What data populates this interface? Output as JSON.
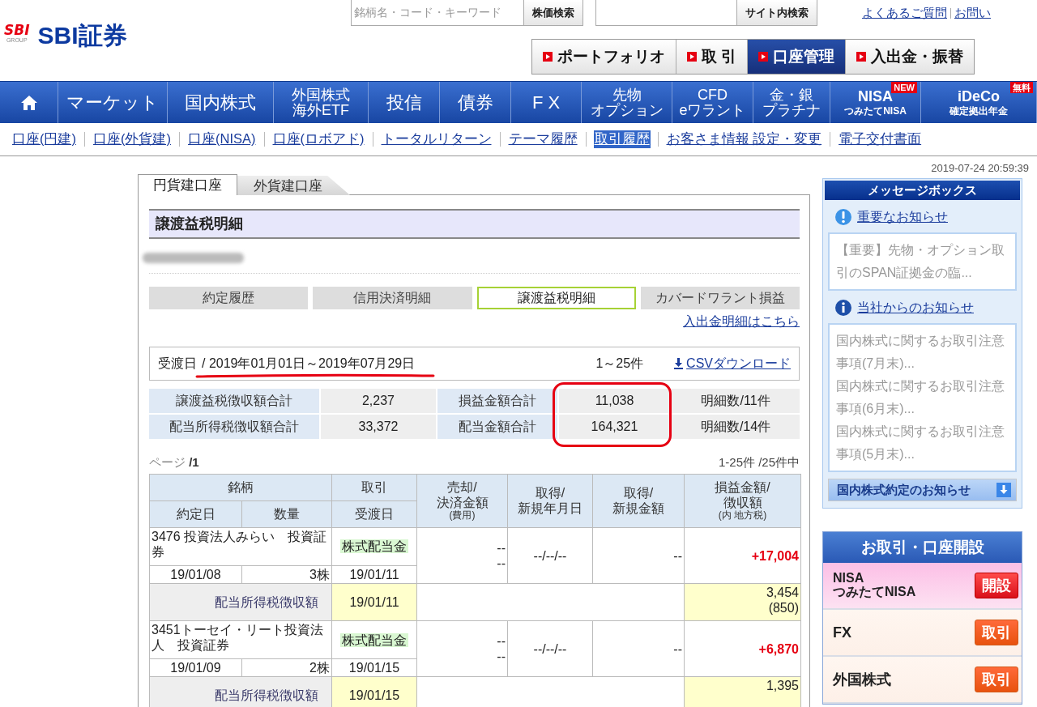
{
  "logo": {
    "mark": "SBI",
    "caption": "GROUP",
    "name": "SBI証券"
  },
  "stock_search": {
    "placeholder": "銘柄名・コード・キーワード",
    "button": "株価検索"
  },
  "site_search": {
    "button": "サイト内検索"
  },
  "help_links": [
    "よくあるご質問",
    "お問い"
  ],
  "quick_nav": [
    {
      "label": "ポートフォリオ",
      "selected": false
    },
    {
      "label": "取 引",
      "selected": false
    },
    {
      "label": "口座管理",
      "selected": true
    },
    {
      "label": "入出金・振替",
      "selected": false
    }
  ],
  "main_nav": [
    {
      "kind": "home"
    },
    {
      "kind": "label",
      "lines": [
        "マーケット"
      ]
    },
    {
      "kind": "label",
      "lines": [
        "国内株式"
      ]
    },
    {
      "kind": "stacked",
      "lines": [
        "外国株式",
        "海外ETF"
      ]
    },
    {
      "kind": "label",
      "lines": [
        "投信"
      ]
    },
    {
      "kind": "label",
      "lines": [
        "債券"
      ]
    },
    {
      "kind": "label",
      "lines": [
        "F X"
      ]
    },
    {
      "kind": "stacked",
      "lines": [
        "先物",
        "オプション"
      ]
    },
    {
      "kind": "stacked",
      "lines": [
        "CFD",
        "eワラント"
      ]
    },
    {
      "kind": "stacked",
      "lines": [
        "金・銀",
        "プラチナ"
      ]
    },
    {
      "kind": "brand",
      "lines": [
        "NISA",
        "つみたてNISA"
      ],
      "badge": "NEW"
    },
    {
      "kind": "brand",
      "lines": [
        "iDeCo",
        "確定拠出年金"
      ],
      "badge": "無料"
    }
  ],
  "sub_nav": [
    {
      "label": "口座(円建)",
      "selected": false
    },
    {
      "label": "口座(外貨建)",
      "selected": false
    },
    {
      "label": "口座(NISA)",
      "selected": false
    },
    {
      "label": "口座(ロボアド)",
      "selected": false
    },
    {
      "label": "トータルリターン",
      "selected": false
    },
    {
      "label": "テーマ履歴",
      "selected": false
    },
    {
      "label": "取引履歴",
      "selected": true
    },
    {
      "label": "お客さま情報 設定・変更",
      "selected": false
    },
    {
      "label": "電子交付書面",
      "selected": false
    }
  ],
  "timestamp": "2019-07-24 20:59:39",
  "account_tabs": [
    {
      "label": "円貨建口座",
      "selected": true
    },
    {
      "label": "外貨建口座",
      "selected": false
    }
  ],
  "section_title": "譲渡益税明細",
  "report_tabs": [
    {
      "label": "約定履歴",
      "selected": false
    },
    {
      "label": "信用決済明細",
      "selected": false
    },
    {
      "label": "譲渡益税明細",
      "selected": true
    },
    {
      "label": "カバードワラント損益",
      "selected": false
    }
  ],
  "deposit_link": "入出金明細はこちら",
  "filter": {
    "label": "受渡日",
    "period": "/ 2019年01月01日～2019年07月29日",
    "underlined": true,
    "range": "1～25件",
    "csv_link": "CSVダウンロード"
  },
  "summary": {
    "columns": [
      {
        "kind": "label",
        "cells": [
          "譲渡益税徴収額合計",
          "配当所得税徴収額合計"
        ]
      },
      {
        "kind": "value",
        "cells": [
          "2,237",
          "33,372"
        ]
      },
      {
        "kind": "label",
        "cells": [
          "損益金額合計",
          "配当金額合計"
        ]
      },
      {
        "kind": "value",
        "cells": [
          "11,038",
          "164,321"
        ],
        "circled": true
      },
      {
        "kind": "count",
        "cells": [
          "明細数/11件",
          "明細数/14件"
        ]
      }
    ]
  },
  "pager": {
    "page": "ページ **/1**",
    "count": "1-25件 /25件中"
  },
  "table": {
    "header_top": [
      "銘柄",
      "取引"
    ],
    "header_bottom": [
      "約定日",
      "数量",
      "受渡日"
    ],
    "header_tall": [
      {
        "lines": [
          "売却/",
          "決済金額"
        ],
        "note": "(費用)"
      },
      {
        "lines": [
          "取得/",
          "新規年月日"
        ]
      },
      {
        "lines": [
          "取得/",
          "新規金額"
        ]
      },
      {
        "lines": [
          "損益金額/",
          "徴収額"
        ],
        "note": "(内 地方税)"
      }
    ],
    "rows": [
      {
        "kind": "trade",
        "name": "3476 投資法人みらい　投資証券",
        "trade_type": "株式配当金",
        "trade_date": "19/01/08",
        "quantity": "3株",
        "settle_date": "19/01/11",
        "sale": [
          "--",
          "--"
        ],
        "acquired_date": "--/--/--",
        "acquired_amount": "--",
        "profit": "+17,004"
      },
      {
        "kind": "tax",
        "label": "配当所得税徴収額",
        "date": "19/01/11",
        "amount": "3,454",
        "local_tax": "(850)"
      },
      {
        "kind": "trade",
        "name": "3451トーセイ・リート投資法人　投資証券",
        "trade_type": "株式配当金",
        "trade_date": "19/01/09",
        "quantity": "2株",
        "settle_date": "19/01/15",
        "sale": [
          "--",
          "--"
        ],
        "acquired_date": "--/--/--",
        "acquired_amount": "--",
        "profit": "+6,870"
      },
      {
        "kind": "tax",
        "label": "配当所得税徴収額",
        "date": "19/01/15",
        "amount": "1,395"
      }
    ]
  },
  "message_box": {
    "title": "メッセージボックス",
    "sections": [
      {
        "kind": "important",
        "link": "重要なお知らせ",
        "items": [
          "【重要】先物・オプション取引のSPAN証拠金の臨..."
        ]
      },
      {
        "kind": "info",
        "link": "当社からのお知らせ",
        "items": [
          "国内株式に関するお取引注意事項(7月末)...",
          "国内株式に関するお取引注意事項(6月末)...",
          "国内株式に関するお取引注意事項(5月末)..."
        ]
      }
    ],
    "footer": "国内株式約定のお知らせ"
  },
  "trade_panel": {
    "title": "お取引・口座開設",
    "items": [
      {
        "kind": "open",
        "lines": [
          "NISA",
          "つみたてNISA"
        ],
        "button": "開設"
      },
      {
        "kind": "trade",
        "lines": [
          "FX"
        ],
        "button": "取引"
      },
      {
        "kind": "trade",
        "lines": [
          "外国株式"
        ],
        "button": "取引"
      }
    ]
  }
}
